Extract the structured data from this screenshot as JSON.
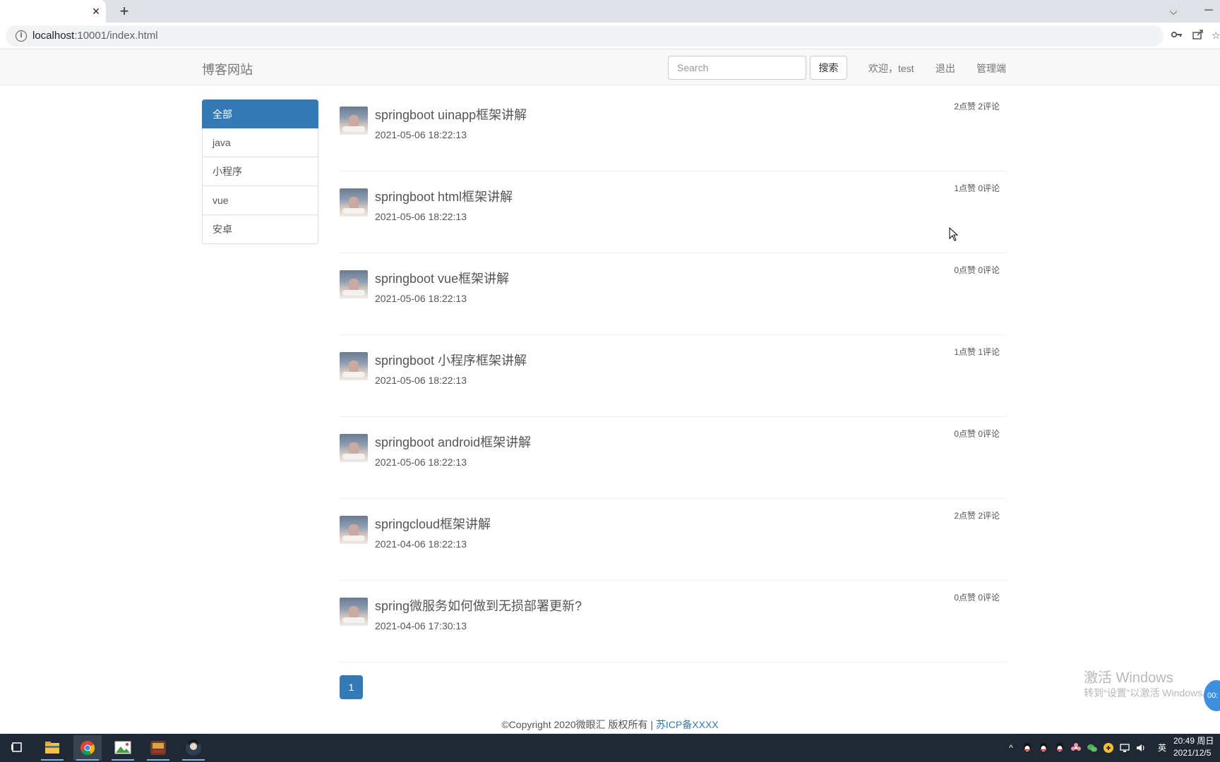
{
  "browser": {
    "tab_close_glyph": "×",
    "new_tab_glyph": "+",
    "tab_list_glyph": "⌵",
    "minimize_glyph": "─",
    "url_host": "localhost",
    "url_rest": ":10001/index.html"
  },
  "navbar": {
    "brand": "博客网站",
    "search_placeholder": "Search",
    "search_button": "搜索",
    "welcome": "欢迎，test",
    "logout": "退出",
    "admin": "管理端"
  },
  "categories": [
    {
      "label": "全部",
      "active": true
    },
    {
      "label": "java",
      "active": false
    },
    {
      "label": "小程序",
      "active": false
    },
    {
      "label": "vue",
      "active": false
    },
    {
      "label": "安卓",
      "active": false
    }
  ],
  "articles": [
    {
      "title": "springboot uinapp框架讲解",
      "date": "2021-05-06 18:22:13",
      "stats": "2点赞 2评论"
    },
    {
      "title": "springboot html框架讲解",
      "date": "2021-05-06 18:22:13",
      "stats": "1点赞 0评论"
    },
    {
      "title": "springboot vue框架讲解",
      "date": "2021-05-06 18:22:13",
      "stats": "0点赞 0评论"
    },
    {
      "title": "springboot 小程序框架讲解",
      "date": "2021-05-06 18:22:13",
      "stats": "1点赞 1评论"
    },
    {
      "title": "springboot android框架讲解",
      "date": "2021-05-06 18:22:13",
      "stats": "0点赞 0评论"
    },
    {
      "title": "springcloud框架讲解",
      "date": "2021-04-06 18:22:13",
      "stats": "2点赞 2评论"
    },
    {
      "title": "spring微服务如何做到无损部署更新?",
      "date": "2021-04-06 17:30:13",
      "stats": "0点赞 0评论"
    }
  ],
  "pagination": {
    "current": "1"
  },
  "footer": {
    "copyright": "©Copyright 2020微眼汇 版权所有 | ",
    "icp": "苏ICP备XXXX"
  },
  "watermark": {
    "title": "激活 Windows",
    "subtitle": "转到“设置”以激活 Windows。"
  },
  "floating_badge": "00:",
  "taskbar": {
    "apps": [
      "task-view-icon",
      "file-explorer-icon",
      "chrome-icon",
      "image-app-icon",
      "game-app-icon",
      "avatar-app-icon"
    ],
    "tray_ime": "英",
    "clock_time": "20:49 周日",
    "clock_date": "2021/12/5"
  },
  "colors": {
    "primary": "#337ab7",
    "navbar_bg": "#f8f8f8",
    "taskbar_bg": "#1f2833"
  }
}
